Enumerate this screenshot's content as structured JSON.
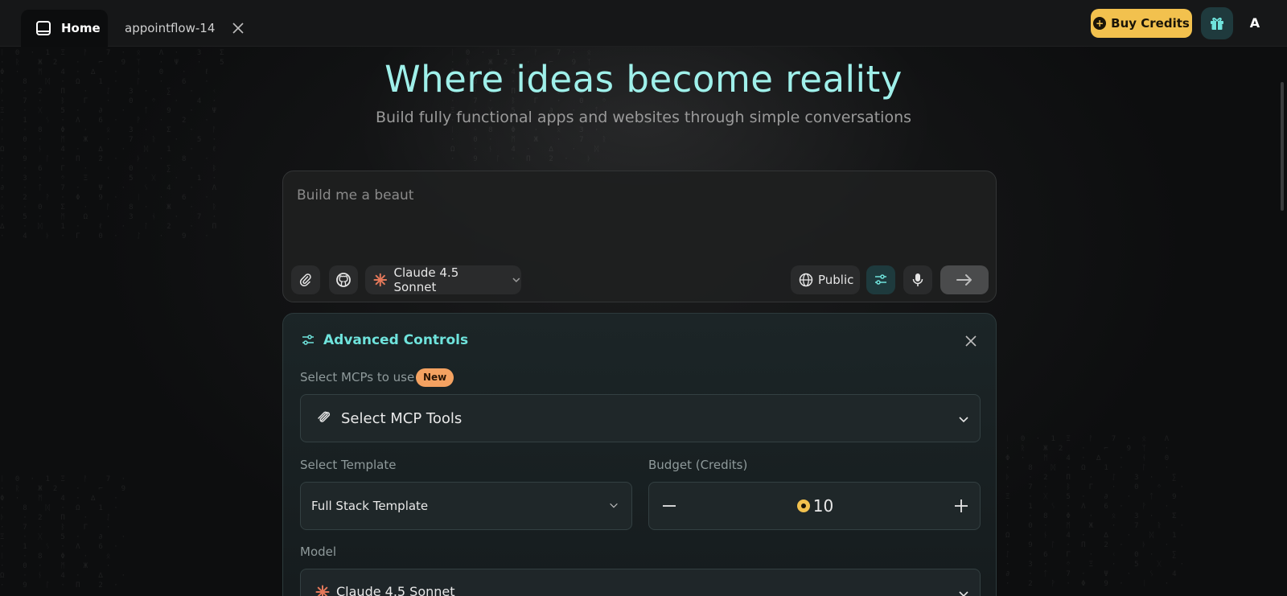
{
  "tabs": {
    "home_label": "Home",
    "project_label": "appointflow-14"
  },
  "header": {
    "buy_credits_label": "Buy Credits",
    "avatar_initial": "A"
  },
  "hero": {
    "title": "Where ideas become reality",
    "subtitle": "Build fully functional apps and websites through simple conversations"
  },
  "prompt": {
    "value": "Build me a beaut",
    "model_label": "Claude 4.5 Sonnet",
    "visibility_label": "Public"
  },
  "advanced": {
    "title": "Advanced Controls",
    "mcp_label": "Select MCPs to use",
    "new_badge": "New",
    "mcp_placeholder": "Select MCP Tools",
    "template_label": "Select Template",
    "template_value": "Full Stack Template",
    "budget_label": "Budget (Credits)",
    "budget_value": "10",
    "model_label": "Model",
    "model_value": "Claude 4.5 Sonnet"
  },
  "colors": {
    "accent": "#6fe3dc",
    "hero_title": "#9ff0ea",
    "credits": "#f2c14e",
    "badge": "#f4a261"
  }
}
